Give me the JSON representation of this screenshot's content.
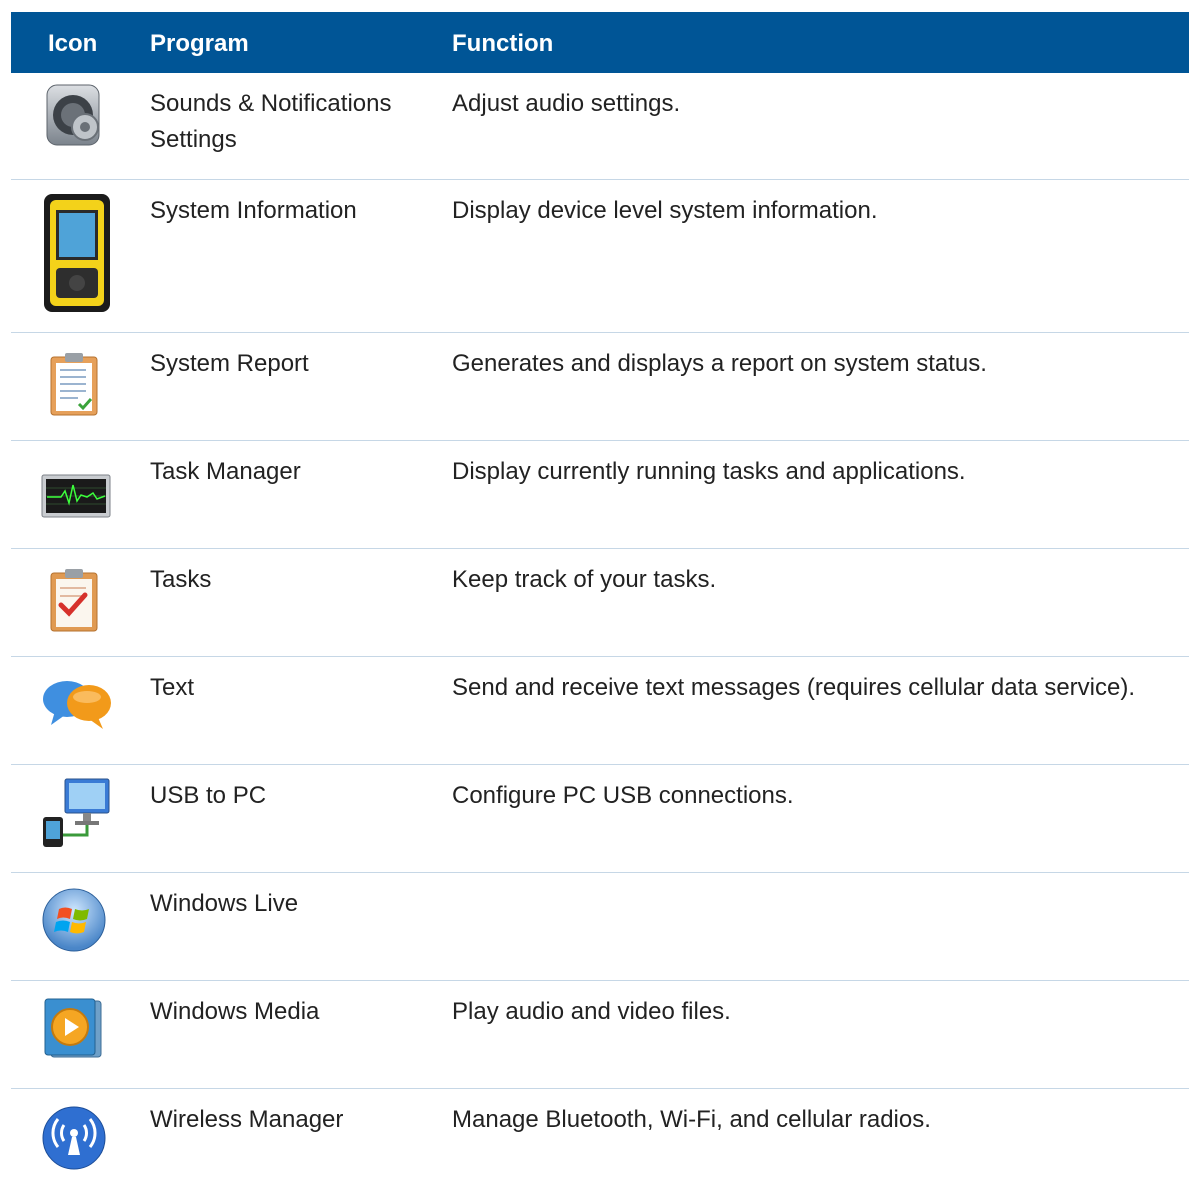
{
  "header": {
    "icon": "Icon",
    "program": "Program",
    "function": "Function"
  },
  "rows": [
    {
      "icon": "sounds-notifications-settings-icon",
      "program": "Sounds & Notifications Settings",
      "function": "Adjust audio settings."
    },
    {
      "icon": "system-information-icon",
      "program": "System Information",
      "function": "Display device level system information."
    },
    {
      "icon": "system-report-icon",
      "program": "System Report",
      "function": "Generates and displays a report on system status."
    },
    {
      "icon": "task-manager-icon",
      "program": "Task Manager",
      "function": "Display currently running tasks and applications."
    },
    {
      "icon": "tasks-icon",
      "program": "Tasks",
      "function": "Keep track of your tasks."
    },
    {
      "icon": "text-icon",
      "program": "Text",
      "function": "Send and receive text messages (requires cellular data service)."
    },
    {
      "icon": "usb-to-pc-icon",
      "program": "USB to PC",
      "function": "Configure PC USB connections."
    },
    {
      "icon": "windows-live-icon",
      "program": "Windows Live",
      "function": ""
    },
    {
      "icon": "windows-media-icon",
      "program": "Windows Media",
      "function": "Play audio and video files."
    },
    {
      "icon": "wireless-manager-icon",
      "program": "Wireless Manager",
      "function": "Manage Bluetooth, Wi-Fi, and cellular radios."
    }
  ],
  "colors": {
    "header_bg": "#005596",
    "header_text": "#ffffff",
    "row_divider": "#c6d7e6"
  }
}
